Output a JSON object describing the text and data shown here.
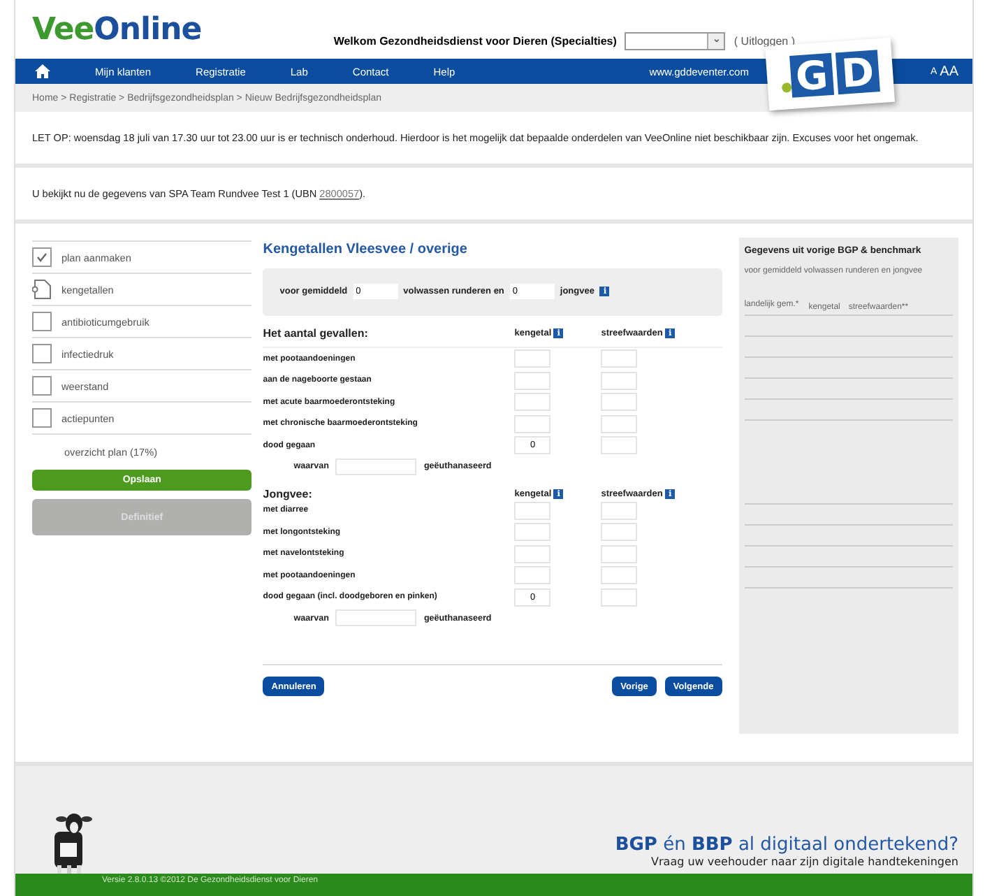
{
  "header": {
    "logo": {
      "part_1": "Vee",
      "part_2": "Online"
    },
    "welcome": "Welkom Gezondheidsdienst voor Dieren (Specialties)",
    "select_arrow": "⌄",
    "logout_open": "(",
    "logout": "Uitloggen",
    "logout_close": ")"
  },
  "nav": {
    "items": [
      "Mijn klanten",
      "Registratie",
      "Lab",
      "Contact",
      "Help"
    ],
    "site": "www.gddeventer.com",
    "font_small": "A",
    "font_large": "AA"
  },
  "brand_logo": {
    "letters": [
      "G",
      "D"
    ]
  },
  "breadcrumb": "Home > Registratie > Bedrijfsgezondheidsplan > Nieuw Bedrijfsgezondheidsplan",
  "notice": "LET OP: woensdag 18 juli van 17.30 uur tot 23.00 uur is er technisch onderhoud. Hierdoor is het mogelijk dat bepaalde onderdelen van VeeOnline niet beschikbaar zijn. Excuses voor het ongemak.",
  "viewing": {
    "text": "U bekijkt nu de gegevens van SPA Team Rundvee Test 1 (UBN ",
    "ubn": "2800057",
    "end": ")."
  },
  "sidebar": {
    "items": [
      {
        "label": "plan aanmaken",
        "kind": "checkbox",
        "checked": true
      },
      {
        "label": "kengetallen",
        "kind": "document"
      },
      {
        "label": "antibioticumgebruik",
        "kind": "checkbox",
        "checked": false
      },
      {
        "label": "infectiedruk",
        "kind": "checkbox",
        "checked": false
      },
      {
        "label": "weerstand",
        "kind": "checkbox",
        "checked": false
      },
      {
        "label": "actiepunten",
        "kind": "checkbox",
        "checked": false
      }
    ],
    "overview": "overzicht plan (17%)",
    "buttons": [
      {
        "label": "Opslaan",
        "disabled": false
      },
      {
        "label": "Definitief",
        "disabled": true
      }
    ]
  },
  "form": {
    "title": "Kengetallen Vleesvee / overige",
    "average": {
      "prefix": "voor gemiddeld",
      "adults": "0",
      "middle": "volwassen runderen en",
      "young": "0",
      "suffix": "jongvee",
      "info": "i"
    },
    "sections": [
      {
        "title": "Het aantal gevallen:",
        "col_1": "kengetal",
        "col_1_info": "i",
        "col_2": "streefwaarden",
        "col_2_info": "i",
        "rows": [
          {
            "label": "met pootaandoeningen",
            "value_1": "",
            "value_2": ""
          },
          {
            "label": "aan de nageboorte gestaan",
            "value_1": "",
            "value_2": ""
          },
          {
            "label": "met acute baarmoederontsteking",
            "value_1": "",
            "value_2": ""
          },
          {
            "label": "met chronische baarmoederontsteking",
            "value_1": "",
            "value_2": ""
          },
          {
            "label": "dood gegaan",
            "value_1": "0",
            "value_2": ""
          }
        ],
        "of_which": {
          "prefix": "waarvan",
          "suffix": "geëuthanaseerd"
        }
      },
      {
        "title": "Jongvee:",
        "col_1": "kengetal",
        "col_1_info": "i",
        "col_2": "streefwaarden",
        "col_2_info": "i",
        "rows": [
          {
            "label": "met diarree",
            "value_1": "",
            "value_2": ""
          },
          {
            "label": "met longontsteking",
            "value_1": "",
            "value_2": ""
          },
          {
            "label": "met navelontsteking",
            "value_1": "",
            "value_2": ""
          },
          {
            "label": "met pootaandoeningen",
            "value_1": "",
            "value_2": ""
          },
          {
            "label": "dood gegaan (incl. doodgeboren en pinken)",
            "value_1": "0",
            "value_2": ""
          }
        ],
        "of_which": {
          "prefix": "waarvan",
          "suffix": "geëuthanaseerd"
        }
      }
    ],
    "buttons": {
      "cancel": "Annuleren",
      "previous": "Vorige",
      "next": "Volgende"
    }
  },
  "benchmark": {
    "title": "Gegevens uit vorige BGP & benchmark",
    "subtitle": "voor gemiddeld volwassen runderen en jongvee",
    "col_1": "landelijk gem.*",
    "col_2": "kengetal",
    "col_3": "streefwaarden**"
  },
  "footer": {
    "headline": {
      "part_1": "BGP",
      "part_2": " én ",
      "part_3": "BBP",
      "part_4": " al digitaal ondertekend?"
    },
    "subline": "Vraag uw veehouder naar zijn digitale handtekeningen",
    "copyright": "Versie 2.8.0.13 ©2012 De Gezondheidsdienst voor Dieren"
  }
}
